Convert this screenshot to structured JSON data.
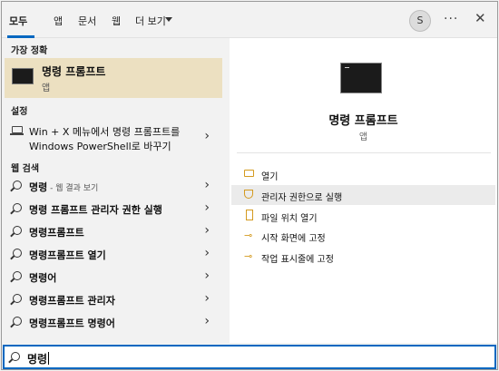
{
  "tabs": [
    {
      "label": "모두"
    },
    {
      "label": "앱"
    },
    {
      "label": "문서"
    },
    {
      "label": "웹"
    },
    {
      "label": "더 보기"
    }
  ],
  "header": {
    "avatar_letter": "S",
    "more": "···",
    "close": "✕"
  },
  "left": {
    "best_match_heading": "가장 정확",
    "best_match": {
      "title": "명령 프롬프트",
      "subtitle": "앱"
    },
    "settings_heading": "설정",
    "setting": {
      "line1": "Win + X 메뉴에서 명령 프롬프트를",
      "line2": "Windows PowerShell로 바꾸기"
    },
    "web_heading": "웹 검색",
    "web_results": [
      {
        "text": "명령",
        "hint": " - 웹 결과 보기"
      },
      {
        "text": "명령 프롬프트 관리자 권한 실행",
        "hint": ""
      },
      {
        "text": "명령프롬프트",
        "hint": ""
      },
      {
        "text": "명령프롬프트 열기",
        "hint": ""
      },
      {
        "text": "명령어",
        "hint": ""
      },
      {
        "text": "명령프롬프트 관리자",
        "hint": ""
      },
      {
        "text": "명령프롬프트 명령어",
        "hint": ""
      }
    ],
    "arrow": "›"
  },
  "right": {
    "title": "명령 프롬프트",
    "subtitle": "앱",
    "actions": [
      {
        "label": "열기",
        "icon": "open-icon"
      },
      {
        "label": "관리자 권한으로 실행",
        "icon": "admin-shield-icon"
      },
      {
        "label": "파일 위치 열기",
        "icon": "file-location-icon"
      },
      {
        "label": "시작 화면에 고정",
        "icon": "pin-icon"
      },
      {
        "label": "작업 표시줄에 고정",
        "icon": "pin-icon"
      }
    ]
  },
  "search": {
    "query": "명령"
  },
  "colors": {
    "accent": "#0067c0",
    "highlight": "#ece0c1",
    "action_icon": "#d49a1f"
  }
}
